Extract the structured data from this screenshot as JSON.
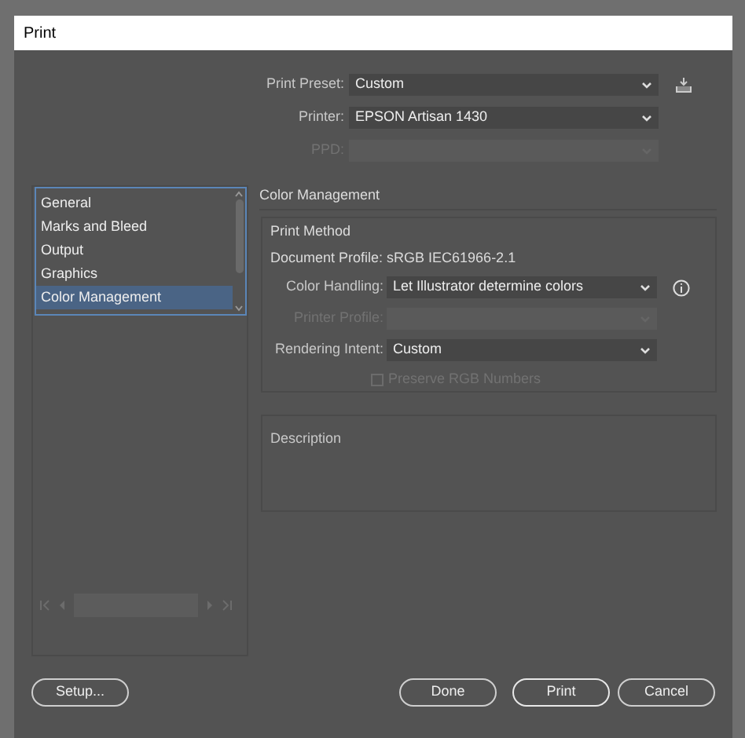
{
  "window": {
    "title": "Print"
  },
  "fields": [
    {
      "label": "Print Preset:",
      "value": "Custom",
      "disabled": false
    },
    {
      "label": "Printer:",
      "value": "EPSON Artisan 1430",
      "disabled": false
    },
    {
      "label": "PPD:",
      "disabled": true
    }
  ],
  "sidebar": {
    "items": [
      {
        "label": "General",
        "selected": false
      },
      {
        "label": "Marks and Bleed",
        "selected": false
      },
      {
        "label": "Output",
        "selected": false
      },
      {
        "label": "Graphics",
        "selected": false
      },
      {
        "label": "Color Management",
        "selected": true
      }
    ]
  },
  "section": {
    "title": "Color Management",
    "group": {
      "title": "Print Method",
      "document_profile": "Document Profile: sRGB IEC61966-2.1",
      "rows": [
        {
          "label": "Color Handling:",
          "value": "Let Illustrator determine colors",
          "disabled": false,
          "info": true
        },
        {
          "label": "Printer Profile:",
          "disabled": true,
          "info": false
        },
        {
          "label": "Rendering Intent:",
          "value": "Custom",
          "disabled": false,
          "info": false
        }
      ],
      "checkbox": {
        "label": "Preserve RGB Numbers",
        "checked": false,
        "disabled": true
      }
    }
  },
  "description": {
    "title": "Description"
  },
  "buttons": [
    {
      "label": "Setup...",
      "kind": "left",
      "default": false
    },
    {
      "label": "Done",
      "kind": "right",
      "default": false
    },
    {
      "label": "Print",
      "kind": "right",
      "default": true
    },
    {
      "label": "Cancel",
      "kind": "right",
      "default": false
    }
  ]
}
